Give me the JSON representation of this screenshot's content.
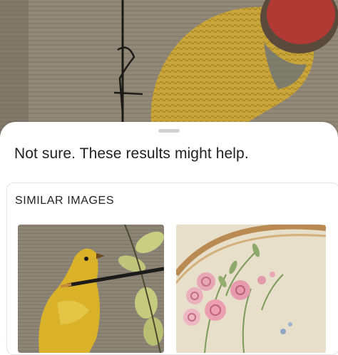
{
  "results": {
    "message": "Not sure. These results might help."
  },
  "similar_images": {
    "title": "SIMILAR IMAGES",
    "items": [
      {
        "subject": "embroidered yellow bird with paintbrush"
      },
      {
        "subject": "embroidery hoop with pink roses"
      }
    ]
  },
  "colors": {
    "sheet_background": "#ffffff",
    "text": "#202124",
    "handle": "#d2d2d2",
    "card_border": "#e3e3e3"
  }
}
